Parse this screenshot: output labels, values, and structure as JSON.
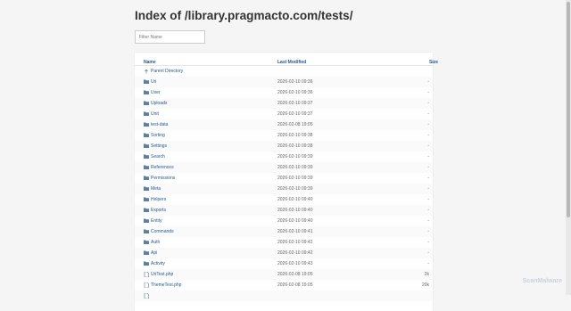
{
  "page": {
    "title": "Index of /library.pragmacto.com/tests/"
  },
  "filter": {
    "placeholder": "Filter Name",
    "value": ""
  },
  "columns": {
    "name": "Name",
    "name_sort": "↓",
    "modified": "Last Modified",
    "modified_sort": "↕",
    "size": "Size",
    "size_sort": "↕"
  },
  "rows": [
    {
      "name": "Parent Directory",
      "modified": "",
      "size": "",
      "icon": "parent-arrow-icon"
    },
    {
      "name": "Uri",
      "modified": "2026-02-10 09:36",
      "size": "-",
      "icon": "folder-icon"
    },
    {
      "name": "User",
      "modified": "2026-02-10 09:36",
      "size": "-",
      "icon": "folder-icon"
    },
    {
      "name": "Uploads",
      "modified": "2026-02-10 09:37",
      "size": "-",
      "icon": "folder-icon"
    },
    {
      "name": "Unit",
      "modified": "2026-02-10 09:37",
      "size": "-",
      "icon": "folder-icon"
    },
    {
      "name": "test-data",
      "modified": "2026-02-08 19:05",
      "size": "-",
      "icon": "folder-icon"
    },
    {
      "name": "Sorting",
      "modified": "2026-02-10 09:38",
      "size": "-",
      "icon": "folder-icon"
    },
    {
      "name": "Settings",
      "modified": "2026-02-10 09:38",
      "size": "-",
      "icon": "folder-icon"
    },
    {
      "name": "Search",
      "modified": "2026-02-10 09:39",
      "size": "-",
      "icon": "folder-icon"
    },
    {
      "name": "References",
      "modified": "2026-02-10 09:39",
      "size": "-",
      "icon": "folder-icon"
    },
    {
      "name": "Permissions",
      "modified": "2026-02-10 09:39",
      "size": "-",
      "icon": "folder-icon"
    },
    {
      "name": "Meta",
      "modified": "2026-02-10 09:39",
      "size": "-",
      "icon": "folder-icon"
    },
    {
      "name": "Helpers",
      "modified": "2026-02-10 09:40",
      "size": "-",
      "icon": "folder-icon"
    },
    {
      "name": "Exports",
      "modified": "2026-02-10 09:40",
      "size": "-",
      "icon": "folder-icon"
    },
    {
      "name": "Entity",
      "modified": "2026-02-10 09:40",
      "size": "-",
      "icon": "folder-icon"
    },
    {
      "name": "Commands",
      "modified": "2026-02-10 09:41",
      "size": "-",
      "icon": "folder-icon"
    },
    {
      "name": "Auth",
      "modified": "2026-02-10 09:42",
      "size": "-",
      "icon": "folder-icon"
    },
    {
      "name": "Api",
      "modified": "2026-02-10 09:42",
      "size": "-",
      "icon": "folder-icon"
    },
    {
      "name": "Activity",
      "modified": "2026-02-10 09:43",
      "size": "-",
      "icon": "folder-icon"
    },
    {
      "name": "UriTest.php",
      "modified": "2026-02-08 19:05",
      "size": "2k",
      "icon": "file-icon"
    },
    {
      "name": "ThemeTest.php",
      "modified": "2026-02-08 19:05",
      "size": "20k",
      "icon": "file-icon"
    },
    {
      "name": "",
      "modified": "",
      "size": "",
      "icon": "file-icon"
    }
  ],
  "watermark": "ScanMalware",
  "colors": {
    "link": "#225aa3",
    "folder": "#5b7fa6",
    "background": "#f5f5f5"
  }
}
